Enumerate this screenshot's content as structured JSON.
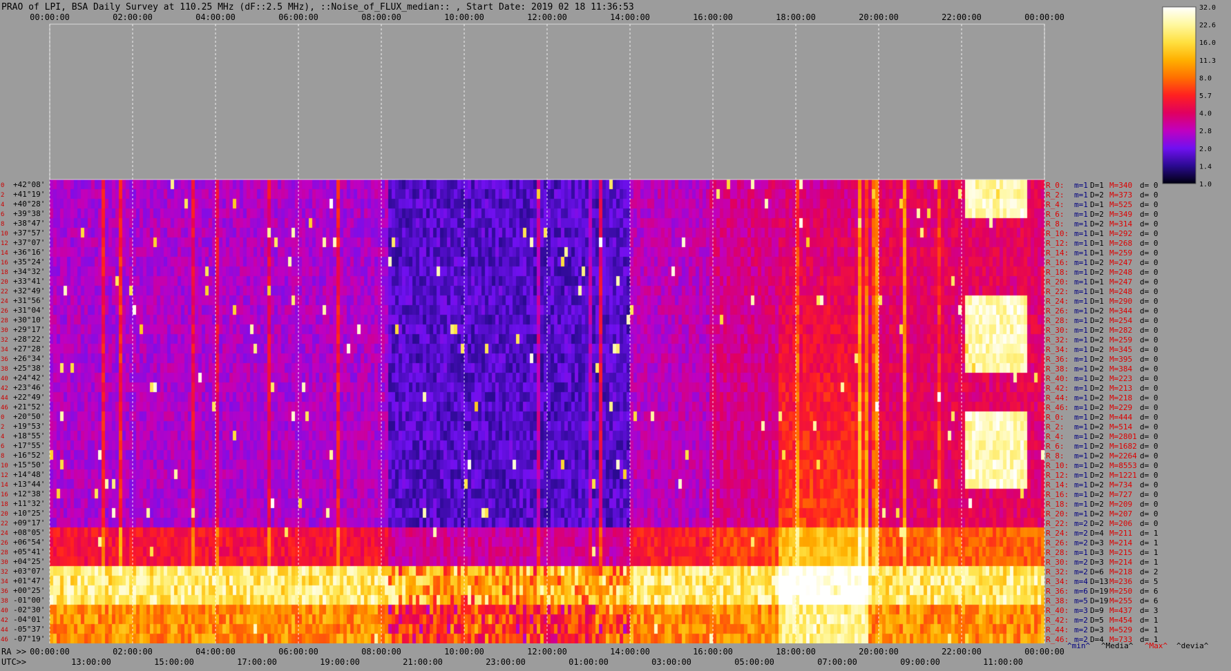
{
  "title": "PRAO of LPI, BSA Daily Survey at 110.25 MHz (dF::2.5 MHz), ::Noise_of_FLUX_median:: , Start Date: 2019 02 18 11:36:53",
  "colors": {
    "background": "#9c9c9c",
    "grid": "#ffffff",
    "text": "#000000",
    "row_index": "#cc0000",
    "stat_red": "#dd0000",
    "stat_blue": "#000080"
  },
  "chart_data": {
    "type": "heatmap",
    "top_axis_labels": [
      "00:00:00",
      "02:00:00",
      "04:00:00",
      "06:00:00",
      "08:00:00",
      "10:00:00",
      "12:00:00",
      "14:00:00",
      "16:00:00",
      "18:00:00",
      "20:00:00",
      "22:00:00",
      "00:00:00"
    ],
    "bottom_ra_prefix": "RA >>",
    "bottom_ra_labels": [
      "00:00:00",
      "02:00:00",
      "04:00:00",
      "06:00:00",
      "08:00:00",
      "10:00:00",
      "12:00:00",
      "14:00:00",
      "16:00:00",
      "18:00:00",
      "20:00:00",
      "22:00:00",
      "00:00:00"
    ],
    "bottom_utc_prefix": "UTC>>",
    "bottom_utc_labels": [
      "13:00:00",
      "15:00:00",
      "17:00:00",
      "19:00:00",
      "21:00:00",
      "23:00:00",
      "01:00:00",
      "03:00:00",
      "05:00:00",
      "07:00:00",
      "09:00:00",
      "11:00:00"
    ],
    "row_indices": [
      "0",
      "2",
      "4",
      "6",
      "8",
      "10",
      "12",
      "14",
      "16",
      "18",
      "20",
      "22",
      "24",
      "26",
      "28",
      "30",
      "32",
      "34",
      "36",
      "38",
      "40",
      "42",
      "44",
      "46",
      "0",
      "2",
      "4",
      "6",
      "8",
      "10",
      "12",
      "14",
      "16",
      "18",
      "20",
      "22",
      "24",
      "26",
      "28",
      "30",
      "32",
      "34",
      "36",
      "38",
      "40",
      "42",
      "44",
      "46"
    ],
    "declinations": [
      "+42°08'",
      "+41°19'",
      "+40°28'",
      "+39°38'",
      "+38°47'",
      "+37°57'",
      "+37°07'",
      "+36°16'",
      "+35°24'",
      "+34°32'",
      "+33°41'",
      "+32°49'",
      "+31°56'",
      "+31°04'",
      "+30°10'",
      "+29°17'",
      "+28°22'",
      "+27°28'",
      "+26°34'",
      "+25°38'",
      "+24°42'",
      "+23°46'",
      "+22°49'",
      "+21°52'",
      "+20°50'",
      "+19°53'",
      "+18°55'",
      "+17°55'",
      "+16°52'",
      "+15°50'",
      "+14°48'",
      "+13°44'",
      "+12°38'",
      "+11°32'",
      "+10°25'",
      "+09°17'",
      "+08°05'",
      "+06°54'",
      "+05°41'",
      "+04°25'",
      "+03°07'",
      "+01°47'",
      "+00°25'",
      "-01°00'",
      "-02°30'",
      "-04°01'",
      "-05°37'",
      "-07°19'"
    ],
    "beam_stats": [
      {
        "r": "R_0:",
        "m": "m=1",
        "D": "D=1",
        "M": "M=340",
        "d": "d= 0"
      },
      {
        "r": "R_2:",
        "m": "m=1",
        "D": "D=2",
        "M": "M=373",
        "d": "d= 0"
      },
      {
        "r": "R_4:",
        "m": "m=1",
        "D": "D=1",
        "M": "M=525",
        "d": "d= 0"
      },
      {
        "r": "R_6:",
        "m": "m=1",
        "D": "D=2",
        "M": "M=349",
        "d": "d= 0"
      },
      {
        "r": "R_8:",
        "m": "m=1",
        "D": "D=2",
        "M": "M=314",
        "d": "d= 0"
      },
      {
        "r": "R_10:",
        "m": "m=1",
        "D": "D=1",
        "M": "M=292",
        "d": "d= 0"
      },
      {
        "r": "R_12:",
        "m": "m=1",
        "D": "D=1",
        "M": "M=268",
        "d": "d= 0"
      },
      {
        "r": "R_14:",
        "m": "m=1",
        "D": "D=1",
        "M": "M=259",
        "d": "d= 0"
      },
      {
        "r": "R_16:",
        "m": "m=1",
        "D": "D=2",
        "M": "M=247",
        "d": "d= 0"
      },
      {
        "r": "R_18:",
        "m": "m=1",
        "D": "D=2",
        "M": "M=248",
        "d": "d= 0"
      },
      {
        "r": "R_20:",
        "m": "m=1",
        "D": "D=1",
        "M": "M=247",
        "d": "d= 0"
      },
      {
        "r": "R_22:",
        "m": "m=1",
        "D": "D=1",
        "M": "M=248",
        "d": "d= 0"
      },
      {
        "r": "R_24:",
        "m": "m=1",
        "D": "D=1",
        "M": "M=290",
        "d": "d= 0"
      },
      {
        "r": "R_26:",
        "m": "m=1",
        "D": "D=2",
        "M": "M=344",
        "d": "d= 0"
      },
      {
        "r": "R_28:",
        "m": "m=1",
        "D": "D=2",
        "M": "M=254",
        "d": "d= 0"
      },
      {
        "r": "R_30:",
        "m": "m=1",
        "D": "D=2",
        "M": "M=282",
        "d": "d= 0"
      },
      {
        "r": "R_32:",
        "m": "m=1",
        "D": "D=2",
        "M": "M=259",
        "d": "d= 0"
      },
      {
        "r": "R_34:",
        "m": "m=1",
        "D": "D=2",
        "M": "M=345",
        "d": "d= 0"
      },
      {
        "r": "R_36:",
        "m": "m=1",
        "D": "D=2",
        "M": "M=395",
        "d": "d= 0"
      },
      {
        "r": "R_38:",
        "m": "m=1",
        "D": "D=2",
        "M": "M=384",
        "d": "d= 0"
      },
      {
        "r": "R_40:",
        "m": "m=1",
        "D": "D=2",
        "M": "M=223",
        "d": "d= 0"
      },
      {
        "r": "R_42:",
        "m": "m=1",
        "D": "D=2",
        "M": "M=213",
        "d": "d= 0"
      },
      {
        "r": "R_44:",
        "m": "m=1",
        "D": "D=2",
        "M": "M=218",
        "d": "d= 0"
      },
      {
        "r": "R_46:",
        "m": "m=1",
        "D": "D=2",
        "M": "M=229",
        "d": "d= 0"
      },
      {
        "r": "R_0:",
        "m": "m=1",
        "D": "D=2",
        "M": "M=444",
        "d": "d= 0"
      },
      {
        "r": "R_2:",
        "m": "m=1",
        "D": "D=2",
        "M": "M=514",
        "d": "d= 0"
      },
      {
        "r": "R_4:",
        "m": "m=1",
        "D": "D=2",
        "M": "M=2801",
        "d": "d= 0"
      },
      {
        "r": "R_6:",
        "m": "m=1",
        "D": "D=2",
        "M": "M=1682",
        "d": "d= 0"
      },
      {
        "r": "R_8:",
        "m": "m=1",
        "D": "D=2",
        "M": "M=2264",
        "d": "d= 0"
      },
      {
        "r": "R_10:",
        "m": "m=1",
        "D": "D=2",
        "M": "M=8553",
        "d": "d= 0"
      },
      {
        "r": "R_12:",
        "m": "m=1",
        "D": "D=2",
        "M": "M=1221",
        "d": "d= 0"
      },
      {
        "r": "R_14:",
        "m": "m=1",
        "D": "D=2",
        "M": "M=734",
        "d": "d= 0"
      },
      {
        "r": "R_16:",
        "m": "m=1",
        "D": "D=2",
        "M": "M=727",
        "d": "d= 0"
      },
      {
        "r": "R_18:",
        "m": "m=1",
        "D": "D=2",
        "M": "M=209",
        "d": "d= 0"
      },
      {
        "r": "R_20:",
        "m": "m=1",
        "D": "D=2",
        "M": "M=207",
        "d": "d= 0"
      },
      {
        "r": "R_22:",
        "m": "m=2",
        "D": "D=2",
        "M": "M=206",
        "d": "d= 0"
      },
      {
        "r": "R_24:",
        "m": "m=2",
        "D": "D=4",
        "M": "M=211",
        "d": "d= 1"
      },
      {
        "r": "R_26:",
        "m": "m=2",
        "D": "D=3",
        "M": "M=214",
        "d": "d= 1"
      },
      {
        "r": "R_28:",
        "m": "m=1",
        "D": "D=3",
        "M": "M=215",
        "d": "d= 1"
      },
      {
        "r": "R_30:",
        "m": "m=2",
        "D": "D=3",
        "M": "M=214",
        "d": "d= 1"
      },
      {
        "r": "R_32:",
        "m": "m=2",
        "D": "D=6",
        "M": "M=218",
        "d": "d= 2"
      },
      {
        "r": "R_34:",
        "m": "m=4",
        "D": "D=13",
        "M": "M=236",
        "d": "d= 5"
      },
      {
        "r": "R_36:",
        "m": "m=6",
        "D": "D=19",
        "M": "M=250",
        "d": "d= 6"
      },
      {
        "r": "R_38:",
        "m": "m=5",
        "D": "D=19",
        "M": "M=255",
        "d": "d= 6"
      },
      {
        "r": "R_40:",
        "m": "m=3",
        "D": "D=9",
        "M": "M=437",
        "d": "d= 3"
      },
      {
        "r": "R_42:",
        "m": "m=2",
        "D": "D=5",
        "M": "M=454",
        "d": "d= 1"
      },
      {
        "r": "R_44:",
        "m": "m=2",
        "D": "D=3",
        "M": "M=529",
        "d": "d= 1"
      },
      {
        "r": "R_46:",
        "m": "m=2",
        "D": "D=4",
        "M": "M=733",
        "d": "d= 1"
      }
    ],
    "stats_legend": [
      "^min^",
      "^Media^",
      "^Max^",
      "^devia^"
    ],
    "colorbar": {
      "labels": [
        "32.0",
        "22.6",
        "16.0",
        "11.3",
        "8.0",
        "5.7",
        "4.0",
        "2.8",
        "2.0",
        "1.4",
        "1.0"
      ],
      "stops": [
        "#ffffff",
        "#fff8a0",
        "#ffe040",
        "#ffb000",
        "#ff7000",
        "#ff2020",
        "#e00060",
        "#c000c0",
        "#7010f0",
        "#2a0a90",
        "#000010"
      ]
    }
  }
}
